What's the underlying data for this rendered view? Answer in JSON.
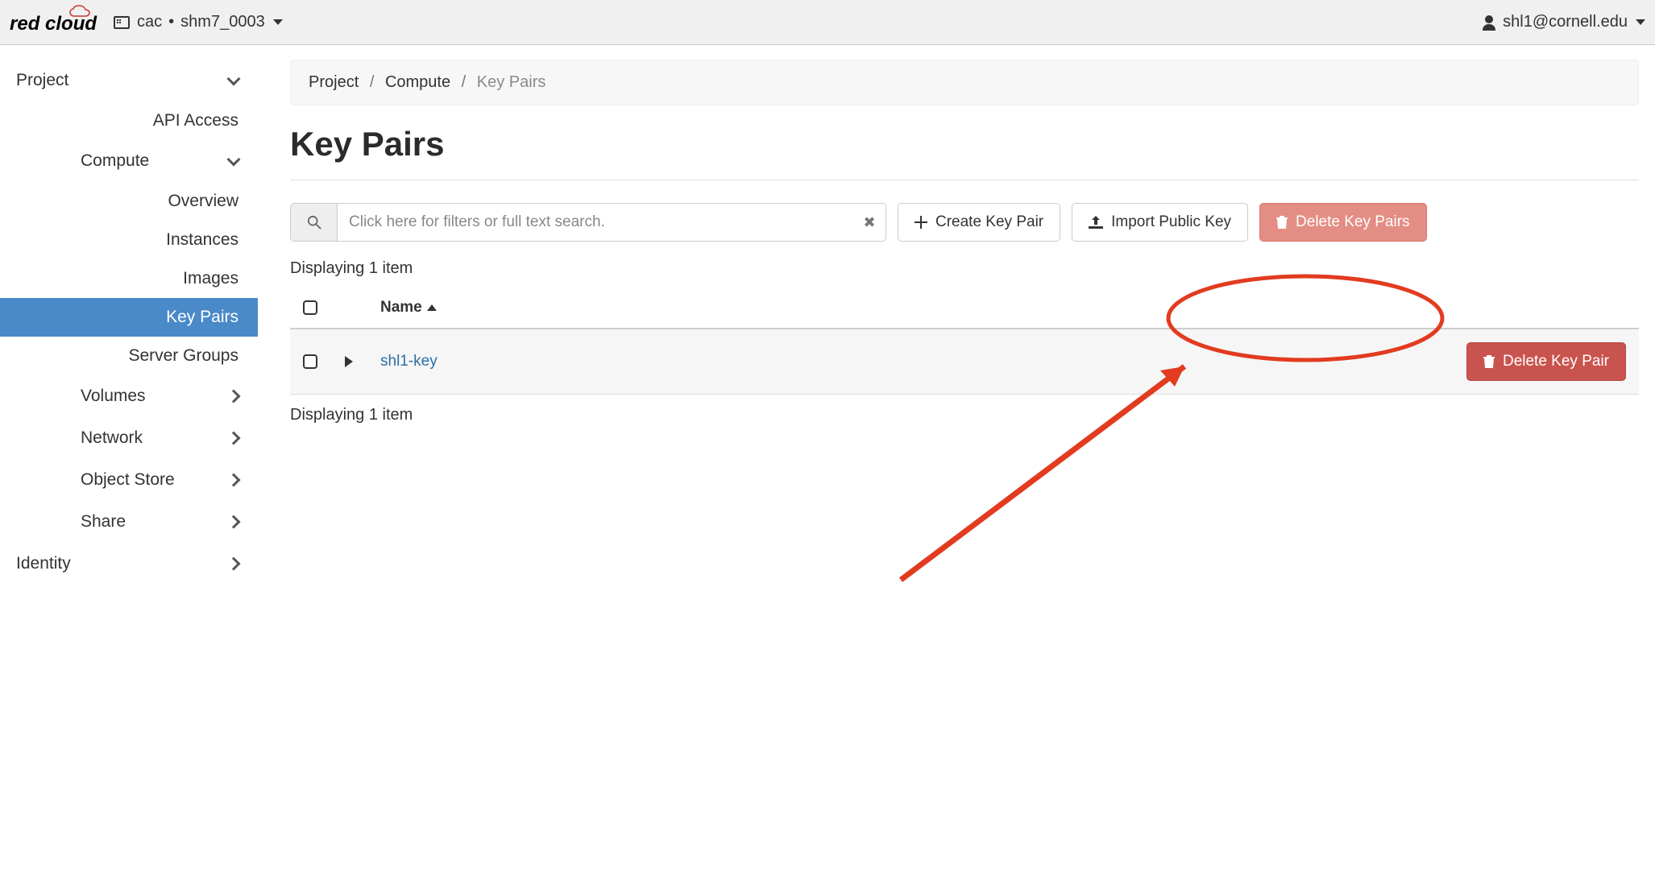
{
  "header": {
    "logo_text_1": "red",
    "logo_text_2": " cloud",
    "project_org": "cac",
    "project_dot": " • ",
    "project_name": "shm7_0003",
    "user": "shl1@cornell.edu"
  },
  "sidebar": {
    "project": "Project",
    "api_access": "API Access",
    "compute": "Compute",
    "overview": "Overview",
    "instances": "Instances",
    "images": "Images",
    "key_pairs": "Key Pairs",
    "server_groups": "Server Groups",
    "volumes": "Volumes",
    "network": "Network",
    "object_store": "Object Store",
    "share": "Share",
    "identity": "Identity"
  },
  "breadcrumb": {
    "a": "Project",
    "b": "Compute",
    "c": "Key Pairs"
  },
  "page": {
    "title": "Key Pairs",
    "search_placeholder": "Click here for filters or full text search.",
    "create_btn": "Create Key Pair",
    "import_btn": "Import Public Key",
    "delete_many_btn": "Delete Key Pairs",
    "count_text": "Displaying 1 item",
    "name_header": "Name",
    "delete_row_btn": "Delete Key Pair"
  },
  "rows": [
    {
      "name": "shl1-key"
    }
  ]
}
